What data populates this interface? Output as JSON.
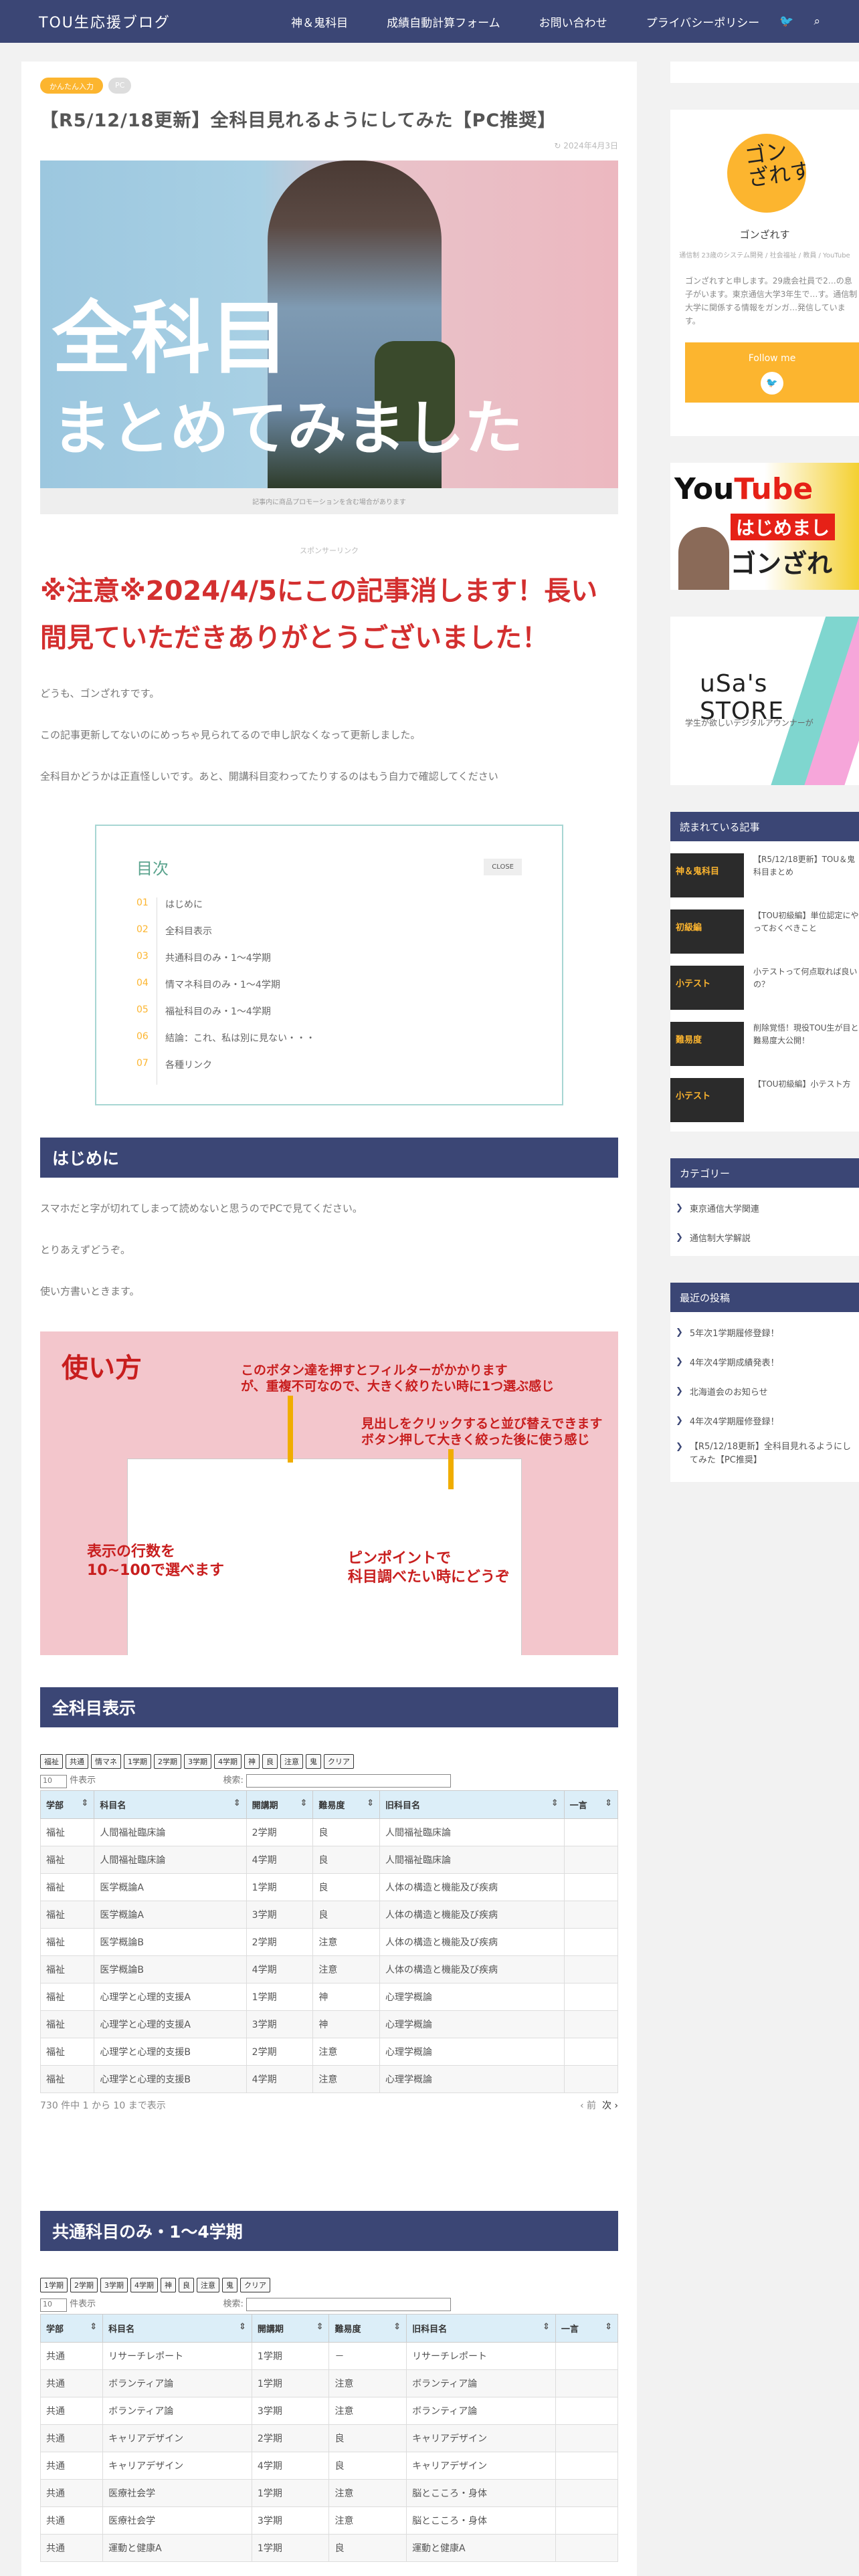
{
  "header": {
    "site_title": "TOU生応援ブログ",
    "nav": [
      "神＆鬼科目",
      "成績自動計算フォーム",
      "お問い合わせ",
      "プライバシーポリシー"
    ],
    "twitter_icon": "twitter-icon",
    "search_icon": "search-icon"
  },
  "article": {
    "category": "かんたん入力",
    "tag": "PC",
    "title": "【R5/12/18更新】全科目見れるようにしてみた【PC推奨】",
    "date": "2024年4月3日",
    "eyecatch_line1": "全科目",
    "eyecatch_line2": "まとめてみました",
    "pr_note": "記事内に商品プロモーションを含む場合があります",
    "sponsor": "スポンサーリンク",
    "notice": "※注意※2024/4/5にこの記事消します！長い間見ていただきありがとうございました！",
    "para1": "どうも、ゴンざれすです。",
    "para2": "この記事更新してないのにめっちゃ見られてるので申し訳なくなって更新しました。",
    "para3": "全科目かどうかは正直怪しいです。あと、開講科目変わってたりするのはもう自力で確認してください",
    "toc": {
      "title": "目次",
      "close": "CLOSE",
      "items": [
        {
          "n": "01",
          "label": "はじめに"
        },
        {
          "n": "02",
          "label": "全科目表示"
        },
        {
          "n": "03",
          "label": "共通科目のみ・1～4学期"
        },
        {
          "n": "04",
          "label": "情マネ科目のみ・1～4学期"
        },
        {
          "n": "05",
          "label": "福祉科目のみ・1～4学期"
        },
        {
          "n": "06",
          "label": "結論：これ、私は別に見ない・・・"
        },
        {
          "n": "07",
          "label": "各種リンク"
        }
      ]
    },
    "h_intro": "はじめに",
    "intro1": "スマホだと字が切れてしまって読めないと思うのでPCで見てください。",
    "intro2": "とりあえずどうぞ。",
    "intro3": "使い方書いときます。",
    "usage": {
      "big": "使い方",
      "a1": "このボタン達を押すとフィルターがかかります\nが、重複不可なので、大きく絞りたい時に1つ選ぶ感じ",
      "a2": "見出しをクリックすると並び替えできます\nボタン押して大きく絞った後に使う感じ",
      "a3": "表示の行数を\n10~100で選べます",
      "a4": "ピンポイントで\n科目調べたい時にどうぞ"
    },
    "h_all": "全科目表示",
    "all_buttons": [
      "福祉",
      "共通",
      "情マネ",
      "1学期",
      "2学期",
      "3学期",
      "4学期",
      "神",
      "良",
      "注意",
      "鬼",
      "クリア"
    ],
    "length_value": "10",
    "length_suffix": "件表示",
    "search_label": "検索:",
    "columns": [
      "学部",
      "科目名",
      "開講期",
      "難易度",
      "旧科目名",
      "一言"
    ],
    "all_rows": [
      [
        "福祉",
        "人間福祉臨床論",
        "2学期",
        "良",
        "人間福祉臨床論",
        ""
      ],
      [
        "福祉",
        "人間福祉臨床論",
        "4学期",
        "良",
        "人間福祉臨床論",
        ""
      ],
      [
        "福祉",
        "医学概論A",
        "1学期",
        "良",
        "人体の構造と機能及び疾病",
        ""
      ],
      [
        "福祉",
        "医学概論A",
        "3学期",
        "良",
        "人体の構造と機能及び疾病",
        ""
      ],
      [
        "福祉",
        "医学概論B",
        "2学期",
        "注意",
        "人体の構造と機能及び疾病",
        ""
      ],
      [
        "福祉",
        "医学概論B",
        "4学期",
        "注意",
        "人体の構造と機能及び疾病",
        ""
      ],
      [
        "福祉",
        "心理学と心理的支援A",
        "1学期",
        "神",
        "心理学概論",
        ""
      ],
      [
        "福祉",
        "心理学と心理的支援A",
        "3学期",
        "神",
        "心理学概論",
        ""
      ],
      [
        "福祉",
        "心理学と心理的支援B",
        "2学期",
        "注意",
        "心理学概論",
        ""
      ],
      [
        "福祉",
        "心理学と心理的支援B",
        "4学期",
        "注意",
        "心理学概論",
        ""
      ]
    ],
    "all_info": "730 件中 1 から 10 まで表示",
    "prev": "前",
    "next": "次",
    "h_common": "共通科目のみ・1～4学期",
    "common_buttons": [
      "1学期",
      "2学期",
      "3学期",
      "4学期",
      "神",
      "良",
      "注意",
      "鬼",
      "クリア"
    ],
    "common_rows": [
      [
        "共通",
        "リサーチレポート",
        "1学期",
        "－",
        "リサーチレポート",
        ""
      ],
      [
        "共通",
        "ボランティア論",
        "1学期",
        "注意",
        "ボランティア論",
        ""
      ],
      [
        "共通",
        "ボランティア論",
        "3学期",
        "注意",
        "ボランティア論",
        ""
      ],
      [
        "共通",
        "キャリアデザイン",
        "2学期",
        "良",
        "キャリアデザイン",
        ""
      ],
      [
        "共通",
        "キャリアデザイン",
        "4学期",
        "良",
        "キャリアデザイン",
        ""
      ],
      [
        "共通",
        "医療社会学",
        "1学期",
        "注意",
        "脳とこころ・身体",
        ""
      ],
      [
        "共通",
        "医療社会学",
        "3学期",
        "注意",
        "脳とこころ・身体",
        ""
      ],
      [
        "共通",
        "運動と健康A",
        "1学期",
        "良",
        "運動と健康A",
        ""
      ]
    ]
  },
  "sidebar": {
    "profile": {
      "avatar_text": "ゴン\nざれす",
      "name": "ゴンざれす",
      "sub": "通信制 23歳のシステム開発 / 社会福祉 / 教員 / YouTube",
      "desc": "ゴンざれすと申します。29歳会社員で2…の息子がいます。東京通信大学3年生で…す。通信制大学に関係する情報をガンガ…発信しています。",
      "follow": "Follow me",
      "twitter_icon": "twitter-icon"
    },
    "youtube": {
      "logo_a": "You",
      "logo_b": "Tube",
      "hajime": "はじめまし",
      "gonza": "ゴンざれ"
    },
    "store": {
      "title": "uSa's STORE",
      "sub": "学生が欲しいデジタルアウンナーが"
    },
    "popular_head": "読まれている記事",
    "popular": [
      {
        "thumb": "神＆鬼科目",
        "title": "【R5/12/18更新】TOU＆鬼科目まとめ"
      },
      {
        "thumb": "初級編",
        "title": "【TOU初級編】単位認定にやっておくべきこと"
      },
      {
        "thumb": "小テスト",
        "title": "小テストって何点取れば良いの？"
      },
      {
        "thumb": "難易度",
        "title": "削除覚悟！現役TOU生が目と難易度大公開！"
      },
      {
        "thumb": "小テスト",
        "title": "【TOU初級編】小テスト方"
      }
    ],
    "category_head": "カテゴリー",
    "categories": [
      "東京通信大学関連",
      "通信制大学解説"
    ],
    "recent_head": "最近の投稿",
    "recent": [
      "5年次1学期履修登録！",
      "4年次4学期成績発表！",
      "北海道会のお知らせ",
      "4年次4学期履修登録！",
      "【R5/12/18更新】全科目見れるようにしてみた【PC推奨】"
    ]
  }
}
